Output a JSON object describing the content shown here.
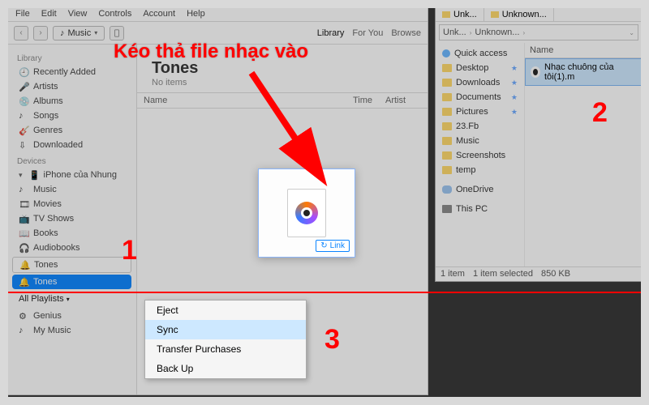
{
  "itunes": {
    "menubar": [
      "File",
      "Edit",
      "View",
      "Controls",
      "Account",
      "Help"
    ],
    "crumb_icon": "music-note",
    "crumb_label": "Music",
    "tabs": {
      "library": "Library",
      "foryou": "For You",
      "browse": "Browse"
    },
    "sidebar": {
      "section_library": "Library",
      "library_items": [
        {
          "icon": "clock-icon",
          "label": "Recently Added"
        },
        {
          "icon": "mic-icon",
          "label": "Artists"
        },
        {
          "icon": "album-icon",
          "label": "Albums"
        },
        {
          "icon": "note-icon",
          "label": "Songs"
        },
        {
          "icon": "guitar-icon",
          "label": "Genres"
        },
        {
          "icon": "download-icon",
          "label": "Downloaded"
        }
      ],
      "section_devices": "Devices",
      "device_name": "iPhone của Nhung",
      "device_items": [
        {
          "icon": "note-icon",
          "label": "Music"
        },
        {
          "icon": "film-icon",
          "label": "Movies"
        },
        {
          "icon": "tv-icon",
          "label": "TV Shows"
        },
        {
          "icon": "book-icon",
          "label": "Books"
        },
        {
          "icon": "audiobook-icon",
          "label": "Audiobooks"
        }
      ],
      "tones_line1": "Tones",
      "tones_line2": "Tones",
      "all_playlists": "All Playlists",
      "playlist_items": [
        {
          "icon": "gear-icon",
          "label": "Genius"
        },
        {
          "icon": "note-icon",
          "label": "My Music"
        }
      ]
    },
    "main": {
      "title": "Tones",
      "subtitle": "No items",
      "col_name": "Name",
      "col_time": "Time",
      "col_artist": "Artist"
    },
    "context_menu": [
      "Eject",
      "Sync",
      "Transfer Purchases",
      "Back Up"
    ]
  },
  "explorer": {
    "tabs": [
      "Unk...",
      "Unknown..."
    ],
    "crumb": [
      "Unk...",
      "Unknown..."
    ],
    "col_name": "Name",
    "tree": {
      "quick": "Quick access",
      "items": [
        "Desktop",
        "Downloads",
        "Documents",
        "Pictures",
        "23.Fb",
        "Music",
        "Screenshots",
        "temp"
      ],
      "onedrive": "OneDrive",
      "thispc": "This PC"
    },
    "file": "Nhạc chuông của tôi(1).m",
    "status": {
      "count": "1 item",
      "selected": "1 item selected",
      "size": "850 KB"
    }
  },
  "drop": {
    "link_label": "Link"
  },
  "annotations": {
    "text": "Kéo thả file nhạc vào",
    "n1": "1",
    "n2": "2",
    "n3": "3"
  }
}
